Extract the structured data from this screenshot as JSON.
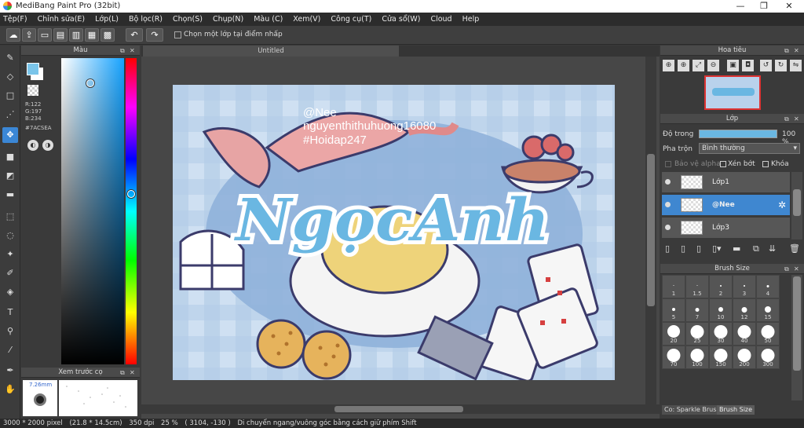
{
  "title": "MediBang Paint Pro (32bit)",
  "window_buttons": [
    "—",
    "❐",
    "✕"
  ],
  "menu": [
    "Tệp(F)",
    "Chỉnh sửa(E)",
    "Lớp(L)",
    "Bộ lọc(R)",
    "Chọn(S)",
    "Chụp(N)",
    "Màu (C)",
    "Xem(V)",
    "Công cụ(T)",
    "Cửa sổ(W)",
    "Cloud",
    "Help"
  ],
  "toolbar": {
    "checkbox_label": "Chọn một lớp tại điểm nhấp"
  },
  "color_panel": {
    "title": "Màu",
    "r": "R:122",
    "g": "G:197",
    "b": "B:234",
    "hex": "#7ACSEA",
    "fg": "#7ac5ea",
    "bg": "#ffffff"
  },
  "canvas": {
    "tab": "Untitled",
    "watermark": [
      "@Nee",
      "nguyenthithuhuong16080",
      "#Hoidap247"
    ],
    "big_text": "NgọcAnh"
  },
  "preview": {
    "title": "Xem trước cọ",
    "size": "7.26mm"
  },
  "navigator": {
    "title": "Hoa tiêu"
  },
  "layer_panel": {
    "title": "Lớp",
    "opacity_label": "Độ trong",
    "opacity_value": "100 %",
    "blend_label": "Pha trộn",
    "blend_value": "Bình thường",
    "protect_alpha": "Bảo vệ alpha",
    "clip": "Xén bớt",
    "lock": "Khóa",
    "layers": [
      {
        "name": "Lớp1"
      },
      {
        "name": "@Nee"
      },
      {
        "name": "Lớp3"
      }
    ]
  },
  "brush_panel": {
    "title": "Brush Size",
    "sizes": [
      "1",
      "1.5",
      "2",
      "3",
      "4",
      "5",
      "7",
      "10",
      "12",
      "15",
      "20",
      "25",
      "30",
      "40",
      "50",
      "70",
      "100",
      "150",
      "200",
      "300"
    ],
    "tab_left": "Co: Sparkle Brush",
    "tab_right": "Brush Size"
  },
  "status": {
    "dims": "3000 * 2000 pixel",
    "size_cm": "(21.8 * 14.5cm)",
    "dpi": "350 dpi",
    "zoom": "25 %",
    "coords": "( 3104, -130 )",
    "hint": "Di chuyển ngang/vuông góc bằng cách giữ phím Shift"
  }
}
